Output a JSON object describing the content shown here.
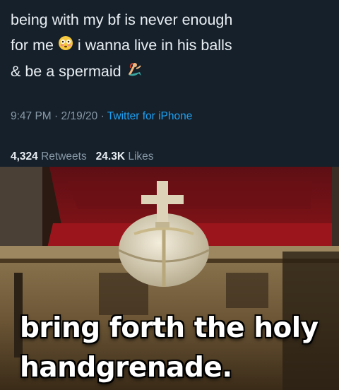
{
  "tweet": {
    "line1": "being with my bf is never enough",
    "line2_a": "for me",
    "line2_b": "i wanna live in his balls",
    "line3": "& be a spermaid",
    "emoji1": "flushed-face-emoji",
    "emoji2": "mermaid-emoji",
    "time": "9:47 PM",
    "date": "2/19/20",
    "separator": "·",
    "source": "Twitter for iPhone",
    "retweets_count": "4,324",
    "retweets_label": "Retweets",
    "likes_count": "24.3K",
    "likes_label": "Likes"
  },
  "meme": {
    "caption_line1": "bring forth the holy",
    "caption_line2": "handgrenade."
  }
}
